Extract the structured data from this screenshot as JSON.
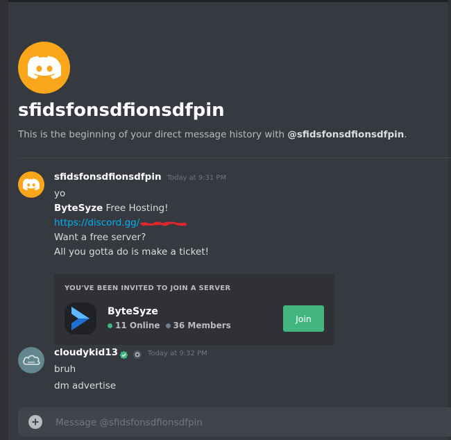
{
  "channel": {
    "title": "sfidsfonsdfionsdfpin",
    "subtitle_prefix": "This is the beginning of your direct message history with ",
    "subtitle_handle": "@sfidsfonsdfionsdfpin",
    "subtitle_suffix": "."
  },
  "messages": [
    {
      "username": "sfidsfonsdfionsdfpin",
      "timestamp": "Today at 9:31 PM",
      "lines": {
        "l1": "yo",
        "l2_bold": "ByteSyze",
        "l2_rest": " Free Hosting!",
        "l3_link": "https://discord.gg/",
        "l4": "Want a free server?",
        "l5": "All you gotta do is make a ticket!"
      },
      "invite": {
        "label": "YOU'VE BEEN INVITED TO JOIN A SERVER",
        "server_name": "ByteSyze",
        "online": "11 Online",
        "members": "36 Members",
        "join_label": "Join"
      }
    },
    {
      "username": "cloudykid13",
      "timestamp": "Today at 9:32 PM",
      "lines": {
        "l1": "bruh",
        "l2": "dm advertise"
      }
    }
  ],
  "composer": {
    "placeholder": "Message @sfidsfonsdfionsdfpin"
  },
  "colors": {
    "background": "#36393f",
    "avatar_orange": "#faa61a",
    "link": "#00b0f4",
    "join_green": "#43b581"
  },
  "icons": [
    "discord-logo-icon",
    "bytesyze-logo-icon",
    "verified-icon",
    "nitro-icon",
    "cloud-avatar-icon",
    "add-icon"
  ]
}
